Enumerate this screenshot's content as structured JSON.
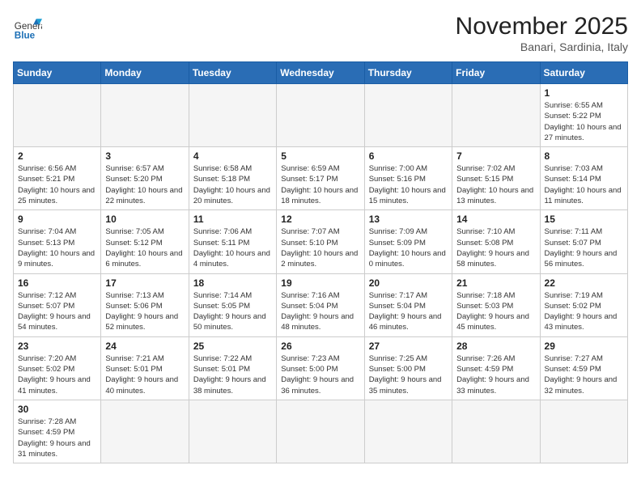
{
  "header": {
    "logo": {
      "general": "General",
      "blue": "Blue"
    },
    "title": "November 2025",
    "location": "Banari, Sardinia, Italy"
  },
  "weekdays": [
    "Sunday",
    "Monday",
    "Tuesday",
    "Wednesday",
    "Thursday",
    "Friday",
    "Saturday"
  ],
  "weeks": [
    [
      {
        "day": null,
        "info": null
      },
      {
        "day": null,
        "info": null
      },
      {
        "day": null,
        "info": null
      },
      {
        "day": null,
        "info": null
      },
      {
        "day": null,
        "info": null
      },
      {
        "day": null,
        "info": null
      },
      {
        "day": "1",
        "info": "Sunrise: 6:55 AM\nSunset: 5:22 PM\nDaylight: 10 hours\nand 27 minutes."
      }
    ],
    [
      {
        "day": "2",
        "info": "Sunrise: 6:56 AM\nSunset: 5:21 PM\nDaylight: 10 hours\nand 25 minutes."
      },
      {
        "day": "3",
        "info": "Sunrise: 6:57 AM\nSunset: 5:20 PM\nDaylight: 10 hours\nand 22 minutes."
      },
      {
        "day": "4",
        "info": "Sunrise: 6:58 AM\nSunset: 5:18 PM\nDaylight: 10 hours\nand 20 minutes."
      },
      {
        "day": "5",
        "info": "Sunrise: 6:59 AM\nSunset: 5:17 PM\nDaylight: 10 hours\nand 18 minutes."
      },
      {
        "day": "6",
        "info": "Sunrise: 7:00 AM\nSunset: 5:16 PM\nDaylight: 10 hours\nand 15 minutes."
      },
      {
        "day": "7",
        "info": "Sunrise: 7:02 AM\nSunset: 5:15 PM\nDaylight: 10 hours\nand 13 minutes."
      },
      {
        "day": "8",
        "info": "Sunrise: 7:03 AM\nSunset: 5:14 PM\nDaylight: 10 hours\nand 11 minutes."
      }
    ],
    [
      {
        "day": "9",
        "info": "Sunrise: 7:04 AM\nSunset: 5:13 PM\nDaylight: 10 hours\nand 9 minutes."
      },
      {
        "day": "10",
        "info": "Sunrise: 7:05 AM\nSunset: 5:12 PM\nDaylight: 10 hours\nand 6 minutes."
      },
      {
        "day": "11",
        "info": "Sunrise: 7:06 AM\nSunset: 5:11 PM\nDaylight: 10 hours\nand 4 minutes."
      },
      {
        "day": "12",
        "info": "Sunrise: 7:07 AM\nSunset: 5:10 PM\nDaylight: 10 hours\nand 2 minutes."
      },
      {
        "day": "13",
        "info": "Sunrise: 7:09 AM\nSunset: 5:09 PM\nDaylight: 10 hours\nand 0 minutes."
      },
      {
        "day": "14",
        "info": "Sunrise: 7:10 AM\nSunset: 5:08 PM\nDaylight: 9 hours\nand 58 minutes."
      },
      {
        "day": "15",
        "info": "Sunrise: 7:11 AM\nSunset: 5:07 PM\nDaylight: 9 hours\nand 56 minutes."
      }
    ],
    [
      {
        "day": "16",
        "info": "Sunrise: 7:12 AM\nSunset: 5:07 PM\nDaylight: 9 hours\nand 54 minutes."
      },
      {
        "day": "17",
        "info": "Sunrise: 7:13 AM\nSunset: 5:06 PM\nDaylight: 9 hours\nand 52 minutes."
      },
      {
        "day": "18",
        "info": "Sunrise: 7:14 AM\nSunset: 5:05 PM\nDaylight: 9 hours\nand 50 minutes."
      },
      {
        "day": "19",
        "info": "Sunrise: 7:16 AM\nSunset: 5:04 PM\nDaylight: 9 hours\nand 48 minutes."
      },
      {
        "day": "20",
        "info": "Sunrise: 7:17 AM\nSunset: 5:04 PM\nDaylight: 9 hours\nand 46 minutes."
      },
      {
        "day": "21",
        "info": "Sunrise: 7:18 AM\nSunset: 5:03 PM\nDaylight: 9 hours\nand 45 minutes."
      },
      {
        "day": "22",
        "info": "Sunrise: 7:19 AM\nSunset: 5:02 PM\nDaylight: 9 hours\nand 43 minutes."
      }
    ],
    [
      {
        "day": "23",
        "info": "Sunrise: 7:20 AM\nSunset: 5:02 PM\nDaylight: 9 hours\nand 41 minutes."
      },
      {
        "day": "24",
        "info": "Sunrise: 7:21 AM\nSunset: 5:01 PM\nDaylight: 9 hours\nand 40 minutes."
      },
      {
        "day": "25",
        "info": "Sunrise: 7:22 AM\nSunset: 5:01 PM\nDaylight: 9 hours\nand 38 minutes."
      },
      {
        "day": "26",
        "info": "Sunrise: 7:23 AM\nSunset: 5:00 PM\nDaylight: 9 hours\nand 36 minutes."
      },
      {
        "day": "27",
        "info": "Sunrise: 7:25 AM\nSunset: 5:00 PM\nDaylight: 9 hours\nand 35 minutes."
      },
      {
        "day": "28",
        "info": "Sunrise: 7:26 AM\nSunset: 4:59 PM\nDaylight: 9 hours\nand 33 minutes."
      },
      {
        "day": "29",
        "info": "Sunrise: 7:27 AM\nSunset: 4:59 PM\nDaylight: 9 hours\nand 32 minutes."
      }
    ],
    [
      {
        "day": "30",
        "info": "Sunrise: 7:28 AM\nSunset: 4:59 PM\nDaylight: 9 hours\nand 31 minutes."
      },
      {
        "day": null,
        "info": null
      },
      {
        "day": null,
        "info": null
      },
      {
        "day": null,
        "info": null
      },
      {
        "day": null,
        "info": null
      },
      {
        "day": null,
        "info": null
      },
      {
        "day": null,
        "info": null
      }
    ]
  ]
}
